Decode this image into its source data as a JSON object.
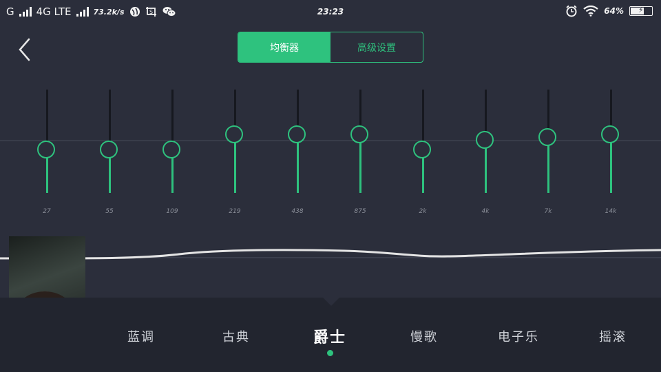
{
  "status_bar": {
    "carrier1": "G",
    "network": "4G LTE",
    "speed": "73.2k/s",
    "time": "23:23",
    "battery_pct": "64%",
    "battery_level": 0.64
  },
  "header": {
    "tabs": [
      {
        "label": "均衡器",
        "active": true
      },
      {
        "label": "高级设置",
        "active": false
      }
    ]
  },
  "equalizer": {
    "bands": [
      {
        "label": "27",
        "level": 0.0
      },
      {
        "label": "55",
        "level": 0.0
      },
      {
        "label": "109",
        "level": 0.0
      },
      {
        "label": "219",
        "level": 0.29
      },
      {
        "label": "438",
        "level": 0.29
      },
      {
        "label": "875",
        "level": 0.29
      },
      {
        "label": "2k",
        "level": 0.0
      },
      {
        "label": "4k",
        "level": 0.19
      },
      {
        "label": "7k",
        "level": 0.24
      },
      {
        "label": "14k",
        "level": 0.29
      }
    ]
  },
  "presets": {
    "items": [
      "蓝调",
      "古典",
      "爵士",
      "慢歌",
      "电子乐",
      "摇滚"
    ],
    "selected_index": 2
  },
  "colors": {
    "accent": "#2ec27e",
    "background": "#2b2e3b",
    "preset_bar": "#22252f"
  }
}
